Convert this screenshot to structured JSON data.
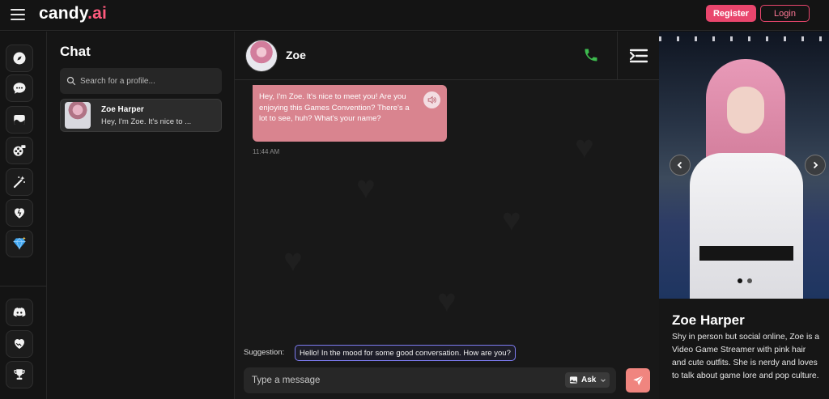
{
  "topbar": {
    "logo_main": "candy",
    "logo_tld": ".ai",
    "register_label": "Register",
    "login_label": "Login"
  },
  "rail": {
    "items": [
      {
        "name": "explore",
        "icon": "compass-icon"
      },
      {
        "name": "chat",
        "icon": "chat-bubble-icon"
      },
      {
        "name": "gallery",
        "icon": "image-icon"
      },
      {
        "name": "generate",
        "icon": "film-reel-icon"
      },
      {
        "name": "create",
        "icon": "magic-wand-icon"
      },
      {
        "name": "my-ai",
        "icon": "heart-icon"
      },
      {
        "name": "premium",
        "icon": "diamond-icon"
      },
      {
        "name": "discord",
        "icon": "discord-icon"
      },
      {
        "name": "affiliate",
        "icon": "handshake-heart-icon"
      },
      {
        "name": "leaderboard",
        "icon": "trophy-icon"
      }
    ]
  },
  "chatlist": {
    "title": "Chat",
    "search_placeholder": "Search for a profile...",
    "profiles": [
      {
        "name": "Zoe Harper",
        "preview": "Hey, I'm Zoe. It's nice to ..."
      }
    ]
  },
  "chat": {
    "name": "Zoe",
    "messages": [
      {
        "text": "Hey, I'm Zoe. It's nice to meet you! Are you enjoying this Games Convention? There's a lot to see, huh? What's your name?",
        "time": "11:44 AM"
      }
    ],
    "suggestion_label": "Suggestion:",
    "suggestion_text": "Hello! In the mood for some good conversation. How are you?",
    "input_placeholder": "Type a message",
    "ask_label": "Ask"
  },
  "panel": {
    "name": "Zoe Harper",
    "bio": "Shy in person but social online, Zoe is a Video Game Streamer with pink hair and cute outfits. She is nerdy and loves to talk about game lore and pop culture.",
    "carousel_total": 2,
    "carousel_active": 1
  },
  "colors": {
    "accent": "#e9466d",
    "bubble": "#d9848f",
    "send": "#f0857f",
    "suggestion_border": "#7d7cf0",
    "call_green": "#3dbb4e"
  }
}
